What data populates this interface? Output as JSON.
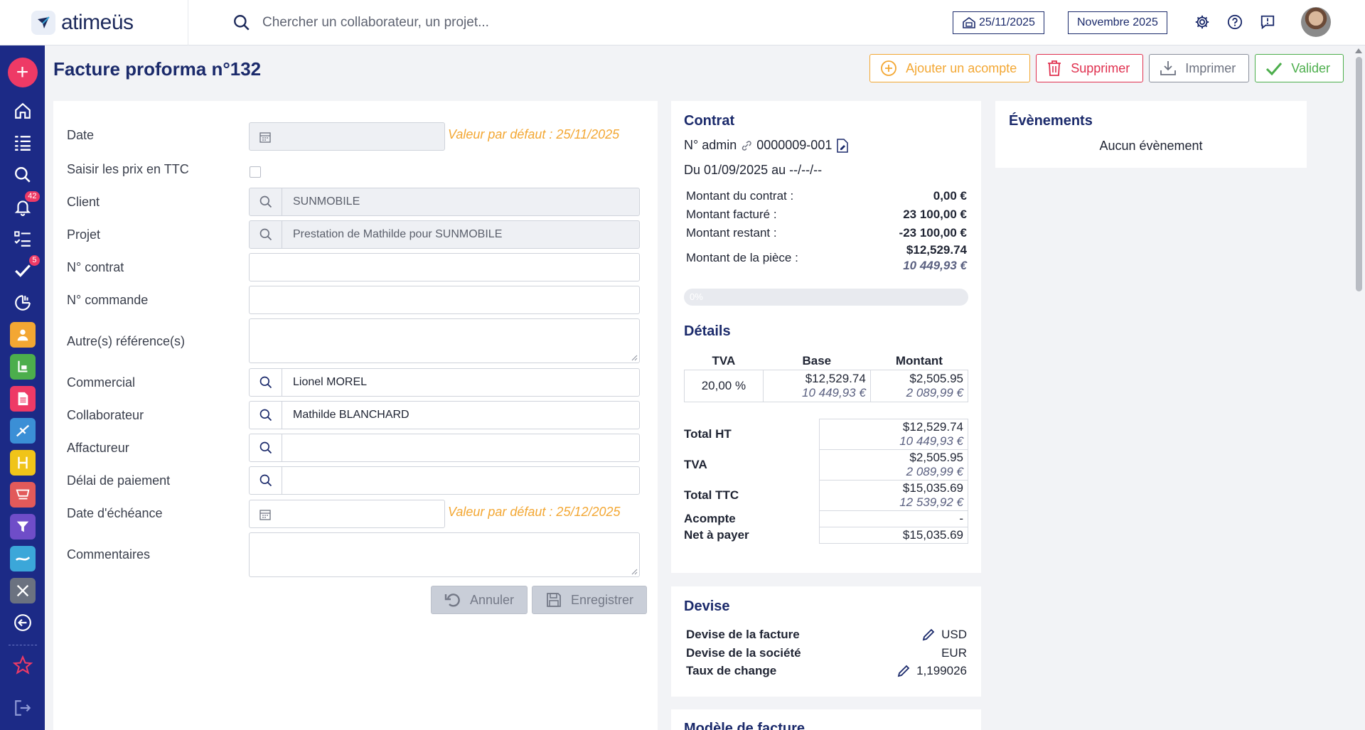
{
  "app": {
    "name": "atimeüs"
  },
  "search": {
    "placeholder": "Chercher un collaborateur, un projet..."
  },
  "topbar": {
    "date": "25/11/2025",
    "period": "Novembre 2025"
  },
  "sidebar": {
    "badges": {
      "notifications": "42",
      "tasks": "5"
    },
    "tile_colors": [
      "#f3a733",
      "#4cae4c",
      "#ee3a66",
      "#3b8fd6",
      "#f0c419",
      "#e25a5a",
      "#6f4dc8",
      "#3ba7d9",
      "#6b7280"
    ]
  },
  "page": {
    "title": "Facture proforma n°132"
  },
  "actions": {
    "add_deposit": "Ajouter un acompte",
    "delete": "Supprimer",
    "print": "Imprimer",
    "validate": "Valider"
  },
  "form": {
    "date_label": "Date",
    "date_default": "Valeur par défaut : 25/11/2025",
    "ttc_label": "Saisir les prix en TTC",
    "client_label": "Client",
    "client_value": "SUNMOBILE",
    "project_label": "Projet",
    "project_value": "Prestation de Mathilde pour SUNMOBILE",
    "contract_label": "N° contrat",
    "order_label": "N° commande",
    "other_refs_label": "Autre(s) référence(s)",
    "sales_label": "Commercial",
    "sales_value": "Lionel MOREL",
    "collab_label": "Collaborateur",
    "collab_value": "Mathilde BLANCHARD",
    "factor_label": "Affactureur",
    "payment_delay_label": "Délai de paiement",
    "due_date_label": "Date d'échéance",
    "due_date_default": "Valeur par défaut : 25/12/2025",
    "comments_label": "Commentaires",
    "cancel": "Annuler",
    "save": "Enregistrer"
  },
  "contract": {
    "title": "Contrat",
    "admin_label": "N° admin",
    "admin_value": "0000009-001",
    "period": "Du 01/09/2025 au --/--/--",
    "amount_contract_label": "Montant du contrat :",
    "amount_contract": "0,00 €",
    "amount_invoiced_label": "Montant facturé :",
    "amount_invoiced": "23 100,00 €",
    "amount_remaining_label": "Montant restant :",
    "amount_remaining": "-23 100,00 €",
    "amount_piece_label": "Montant de la pièce :",
    "amount_piece": "$12,529.74",
    "amount_piece_eur": "10 449,93 €",
    "progress_label": "0%",
    "progress": 0
  },
  "details": {
    "title": "Détails",
    "headers": [
      "TVA",
      "Base",
      "Montant"
    ],
    "rows": [
      {
        "rate": "20,00 %",
        "base": "$12,529.74",
        "base_eur": "10 449,93 €",
        "amount": "$2,505.95",
        "amount_eur": "2 089,99 €"
      }
    ],
    "total_ht_label": "Total HT",
    "total_ht": "$12,529.74",
    "total_ht_eur": "10 449,93 €",
    "tva_label": "TVA",
    "tva": "$2,505.95",
    "tva_eur": "2 089,99 €",
    "total_ttc_label": "Total TTC",
    "total_ttc": "$15,035.69",
    "total_ttc_eur": "12 539,92 €",
    "deposit_label": "Acompte",
    "deposit": "-",
    "net_label": "Net à payer",
    "net": "$15,035.69"
  },
  "currency": {
    "title": "Devise",
    "invoice_label": "Devise de la facture",
    "invoice_value": "USD",
    "company_label": "Devise de la société",
    "company_value": "EUR",
    "rate_label": "Taux de change",
    "rate_value": "1,199026"
  },
  "model": {
    "title": "Modèle de facture"
  },
  "events": {
    "title": "Évènements",
    "empty": "Aucun évènement"
  }
}
